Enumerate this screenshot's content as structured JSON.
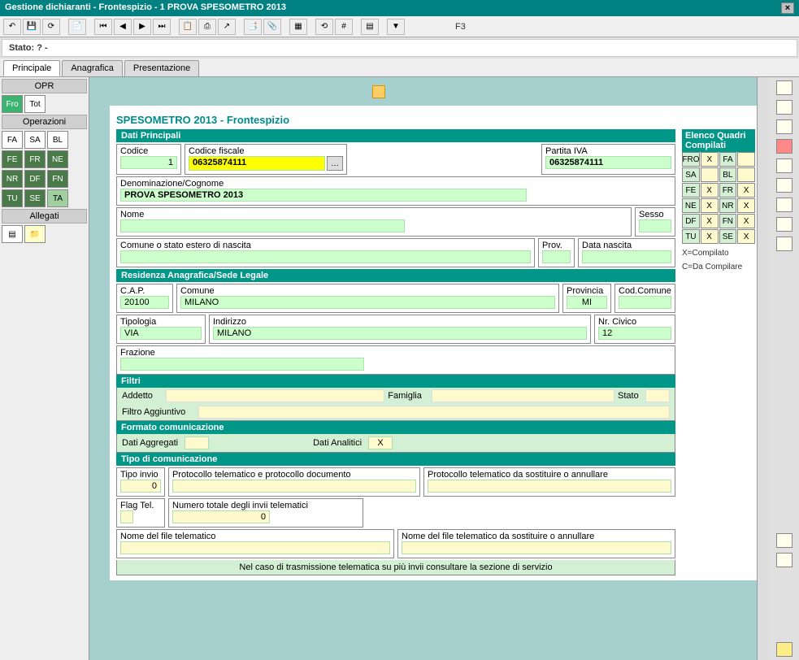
{
  "title": "Gestione dichiaranti -  Frontespizio - 1 PROVA SPESOMETRO 2013",
  "fkey": "F3",
  "status": "Stato: ? -",
  "tabs": {
    "t1": "Principale",
    "t2": "Anagrafica",
    "t3": "Presentazione"
  },
  "left": {
    "opr": "OPR",
    "fro": "Fro",
    "tot": "Tot",
    "operazioni": "Operazioni",
    "fa": "FA",
    "sa": "SA",
    "bl": "BL",
    "fe": "FE",
    "fr": "FR",
    "ne": "NE",
    "nr": "NR",
    "df": "DF",
    "fn": "FN",
    "tu": "TU",
    "se": "SE",
    "ta": "TA",
    "allegati": "Allegati"
  },
  "doc": {
    "title": "SPESOMETRO 2013 - Frontespizio",
    "dati_principali": "Dati Principali",
    "codice_lbl": "Codice",
    "codice_val": "1",
    "cf_lbl": "Codice fiscale",
    "cf_val": "06325874111",
    "piva_lbl": "Partita IVA",
    "piva_val": "06325874111",
    "denom_lbl": "Denominazione/Cognome",
    "denom_val": "PROVA SPESOMETRO 2013",
    "nome_lbl": "Nome",
    "nome_val": "",
    "sesso_lbl": "Sesso",
    "sesso_val": "",
    "comune_nascita_lbl": "Comune o stato estero di nascita",
    "comune_nascita_val": "",
    "prov_lbl": "Prov.",
    "prov_val": "",
    "data_nascita_lbl": "Data nascita",
    "data_nascita_val": "",
    "residenza_head": "Residenza Anagrafica/Sede Legale",
    "cap_lbl": "C.A.P.",
    "cap_val": "20100",
    "comune_lbl": "Comune",
    "comune_val": "MILANO",
    "provincia_lbl": "Provincia",
    "provincia_val": "MI",
    "codcomune_lbl": "Cod.Comune",
    "codcomune_val": "",
    "tipologia_lbl": "Tipologia",
    "tipologia_val": "VIA",
    "indirizzo_lbl": "Indirizzo",
    "indirizzo_val": "MILANO",
    "civico_lbl": "Nr. Civico",
    "civico_val": "12",
    "frazione_lbl": "Frazione",
    "frazione_val": "",
    "filtri_head": "Filtri",
    "addetto_lbl": "Addetto",
    "famiglia_lbl": "Famiglia",
    "stato_lbl": "Stato",
    "filtro_agg_lbl": "Filtro Aggiuntivo",
    "formato_head": "Formato comunicazione",
    "aggregati_lbl": "Dati Aggregati",
    "analitici_lbl": "Dati Analitici",
    "analitici_val": "X",
    "tipo_head": "Tipo di comunicazione",
    "tipo_invio_lbl": "Tipo invio",
    "tipo_invio_val": "0",
    "proto_doc_lbl": "Protocollo telematico e protocollo documento",
    "proto_sost_lbl": "Protocollo telematico da sostituire o annullare",
    "flagtel_lbl": "Flag Tel.",
    "numinvii_lbl": "Numero totale degli invii telematici",
    "numinvii_val": "0",
    "nomefile_lbl": "Nome del file telematico",
    "nomefile_sost_lbl": "Nome del file telematico da sostituire o annullare",
    "footer": "Nel caso di trasmissione telematica su più invii consultare la sezione di servizio"
  },
  "quadri": {
    "head": "Elenco Quadri Compilati",
    "rows": [
      [
        "FRO",
        "X",
        "FA",
        ""
      ],
      [
        "SA",
        "",
        "BL",
        ""
      ],
      [
        "FE",
        "X",
        "FR",
        "X"
      ],
      [
        "NE",
        "X",
        "NR",
        "X"
      ],
      [
        "DF",
        "X",
        "FN",
        "X"
      ],
      [
        "TU",
        "X",
        "SE",
        "X"
      ]
    ],
    "legend1": "X=Compilato",
    "legend2": "C=Da Compilare"
  }
}
